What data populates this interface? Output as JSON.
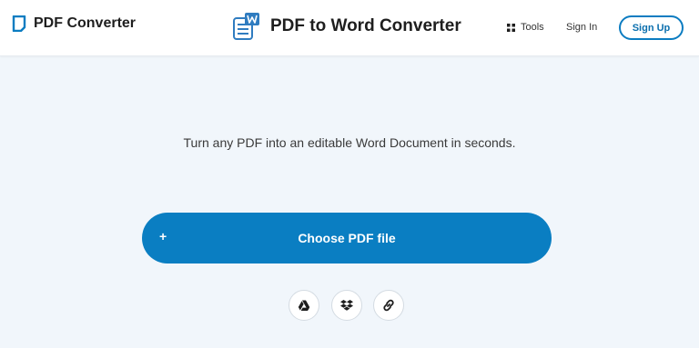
{
  "header": {
    "logo_text": "PDF Converter",
    "page_title": "PDF to Word Converter",
    "tools_label": "Tools",
    "signin_label": "Sign In",
    "signup_label": "Sign Up"
  },
  "main": {
    "tagline": "Turn any PDF into an editable Word Document in seconds.",
    "choose_plus": "+",
    "choose_label": "Choose PDF file",
    "sources": [
      {
        "icon": "google-drive-icon"
      },
      {
        "icon": "dropbox-icon"
      },
      {
        "icon": "link-icon"
      }
    ]
  },
  "colors": {
    "accent": "#0a7ec2",
    "background": "#f1f6fb",
    "header_bg": "#ffffff"
  }
}
